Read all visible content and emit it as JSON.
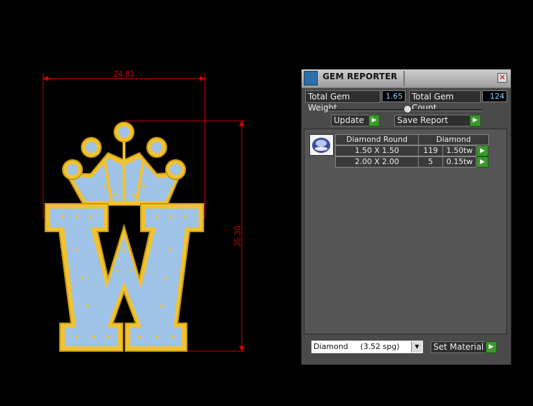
{
  "viewport": {
    "width_dimension": "24.81",
    "height_dimension": "35.30",
    "dimension_color": "#d40000",
    "gold_color": "#f1c232",
    "gem_color": "#9ec3e6"
  },
  "panel": {
    "title": "GEM REPORTER",
    "total_weight_label": "Total Gem Weight",
    "total_weight_value": "1.65",
    "total_count_label": "Total Gem Count",
    "total_count_value": "124",
    "update_label": "Update",
    "save_report_label": "Save Report",
    "table": {
      "headers": [
        "Diamond Round",
        "Diamond"
      ],
      "rows": [
        {
          "size": "1.50 X 1.50",
          "count": "119",
          "weight": "1.50tw"
        },
        {
          "size": "2.00 X 2.00",
          "count": "5",
          "weight": "0.15tw"
        }
      ]
    },
    "material_select": "Diamond     (3.52 spg)",
    "set_material_label": "Set Material",
    "accent_green": "#3a9a2a"
  }
}
